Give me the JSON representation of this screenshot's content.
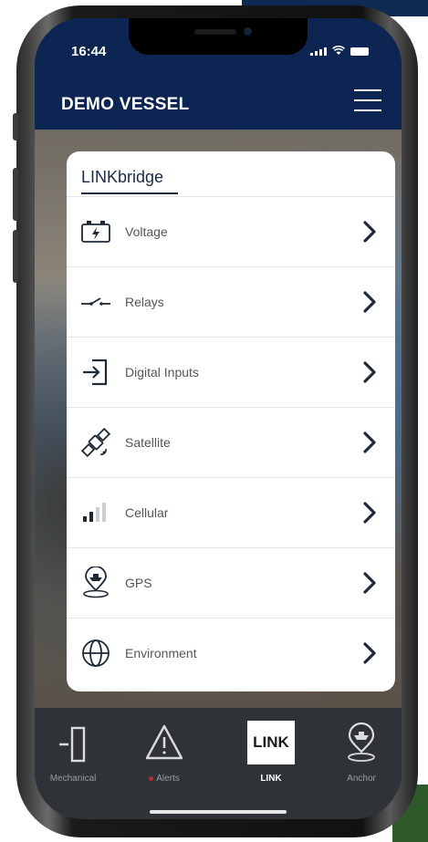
{
  "status": {
    "time": "16:44"
  },
  "header": {
    "title": "DEMO VESSEL"
  },
  "card": {
    "title": "LINKbridge",
    "items": [
      {
        "label": "Voltage",
        "icon": "battery-bolt-icon"
      },
      {
        "label": "Relays",
        "icon": "relay-switch-icon"
      },
      {
        "label": "Digital Inputs",
        "icon": "input-arrow-icon"
      },
      {
        "label": "Satellite",
        "icon": "satellite-icon"
      },
      {
        "label": "Cellular",
        "icon": "cellular-signal-icon"
      },
      {
        "label": "GPS",
        "icon": "boat-pin-icon"
      },
      {
        "label": "Environment",
        "icon": "globe-icon"
      }
    ]
  },
  "nav": {
    "items": [
      {
        "label": "Mechanical",
        "icon": "door-exit-icon"
      },
      {
        "label": "Alerts",
        "icon": "warning-icon"
      },
      {
        "label": "LINK",
        "box_text": "LINK",
        "icon": "link-logo-icon",
        "active": true
      },
      {
        "label": "Anchor",
        "icon": "anchor-pin-icon"
      }
    ]
  },
  "colors": {
    "header_bg": "#0c2552",
    "nav_bg": "#2f3236",
    "accent_title": "#1a2a44",
    "alert_dot": "#c0282a"
  }
}
